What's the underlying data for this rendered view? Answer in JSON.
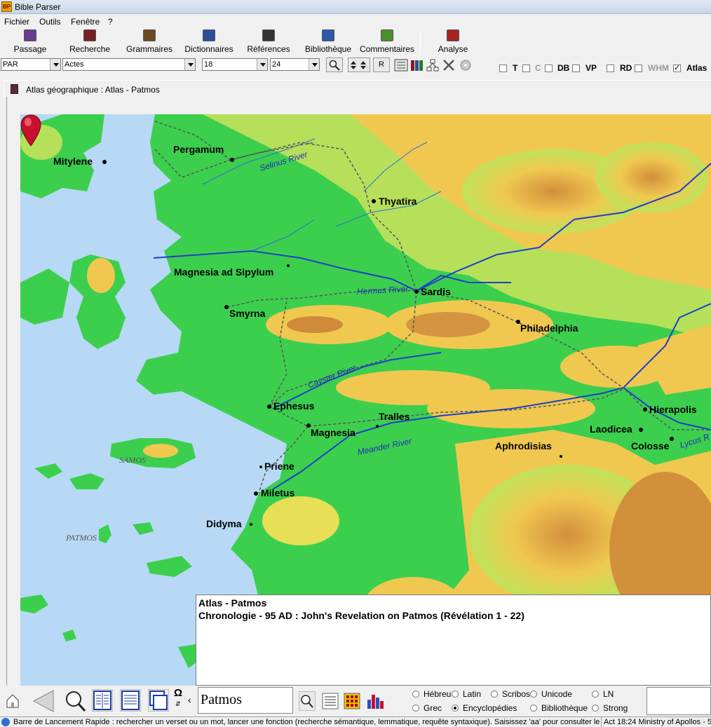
{
  "window": {
    "title": "Bible Parser",
    "icon": "bible-parser-icon"
  },
  "menu": [
    "Fichier",
    "Outils",
    "Fenêtre",
    "?"
  ],
  "toolbar": [
    {
      "label": "Passage",
      "icon": "book-icon",
      "color": "#6a3b8f"
    },
    {
      "label": "Recherche",
      "icon": "magnifier-icon",
      "color": "#7a1f1f"
    },
    {
      "label": "Grammaires",
      "icon": "grammar-icon",
      "color": "#6b4a1f"
    },
    {
      "label": "Dictionnaires",
      "icon": "dictionary-icon",
      "color": "#2d4d9c"
    },
    {
      "label": "Références",
      "icon": "references-icon",
      "color": "#333333"
    },
    {
      "label": "Bibliothèque",
      "icon": "library-icon",
      "color": "#2d5aa8"
    },
    {
      "label": "Commentaires",
      "icon": "commentary-icon",
      "color": "#4a8f2a"
    },
    {
      "label": "Analyse",
      "icon": "analyse-icon",
      "color": "#a8231f"
    }
  ],
  "selectors": {
    "version": "PAR",
    "book": "Actes",
    "chapter": "18",
    "verse": "24",
    "r_button": "R"
  },
  "checkboxes": [
    {
      "label": "T",
      "checked": false,
      "enabled": true
    },
    {
      "label": "C",
      "checked": false,
      "enabled": false
    },
    {
      "label": "DB",
      "checked": false,
      "enabled": true
    },
    {
      "label": "VP",
      "checked": false,
      "enabled": true
    },
    {
      "label": "RD",
      "checked": false,
      "enabled": true
    },
    {
      "label": "WHM",
      "checked": false,
      "enabled": false
    },
    {
      "label": "Atlas",
      "checked": true,
      "enabled": true
    }
  ],
  "child_window": {
    "title": "Atlas géographique : Atlas - Patmos"
  },
  "map": {
    "cities": [
      "Pergamum",
      "Mitylene",
      "Thyatira",
      "Magnesia ad Sipylum",
      "Sardis",
      "Smyrna",
      "Philadelphia",
      "Ephesus",
      "Tralles",
      "Magnesia",
      "Hierapolis",
      "Laodicea",
      "Colosse",
      "Aphrodisias",
      "Priene",
      "Miletus",
      "Didyma"
    ],
    "rivers": [
      "Selinus River",
      "Hermus River",
      "Cayster River",
      "Meander River",
      "Lycus R"
    ],
    "islands": [
      "SAMOS",
      "PATMOS"
    ],
    "colors": {
      "sea": "#b7d9f5",
      "lowland": "#3ccf4e",
      "hills": "#f0c850",
      "highland": "#c0792f",
      "river": "#1e3fc8",
      "road": "#555555",
      "marker": "#c8102e"
    }
  },
  "info": {
    "title": "Atlas - Patmos",
    "line": "Chronologie - 95 AD : John's Revelation on Patmos (Révélation 1 - 22)"
  },
  "search": {
    "value": "Patmos"
  },
  "bottom_icons": {
    "omega": "Ω",
    "chevron": "‹"
  },
  "radios": [
    {
      "label": "Hébreu",
      "checked": false
    },
    {
      "label": "Latin",
      "checked": false
    },
    {
      "label": "Scribos",
      "checked": false
    },
    {
      "label": "Unicode",
      "checked": false
    },
    {
      "label": "LN",
      "checked": false
    },
    {
      "label": "Grec",
      "checked": false
    },
    {
      "label": "Encyclopédies",
      "checked": true
    },
    {
      "label": "Bibliothèque",
      "checked": false
    },
    {
      "label": "Strong",
      "checked": false
    }
  ],
  "status": {
    "left": "Barre de Lancement Rapide : rechercher un verset ou un mot, lancer une fonction (recherche sémantique, lemmatique, requête syntaxique). Saisissez 'aa' pour consulter les racc",
    "right": "Act 18:24 Ministry of Apollos - 5"
  }
}
